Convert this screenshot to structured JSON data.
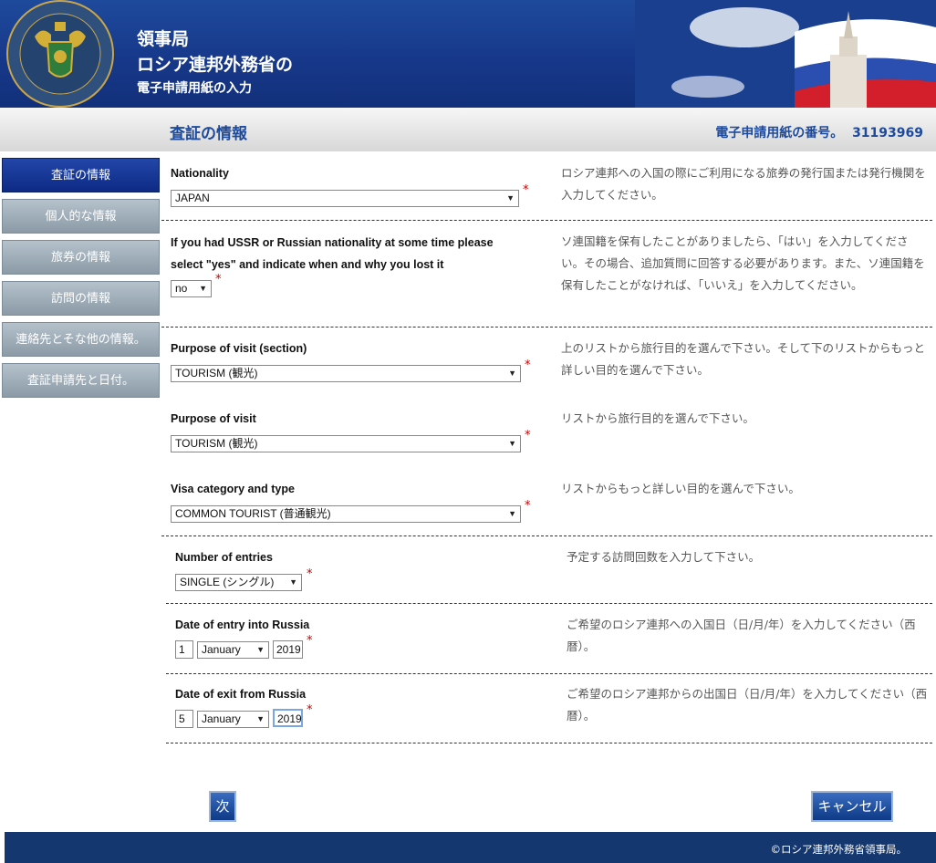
{
  "header": {
    "line1": "領事局",
    "line2": "ロシア連邦外務省の",
    "line3": "電子申請用紙の入力"
  },
  "titlebar": {
    "title": "査証の情報",
    "app_number_label": "電子申請用紙の番号。",
    "app_number": "31193969"
  },
  "sidebar": {
    "items": [
      {
        "label": "査証の情報"
      },
      {
        "label": "個人的な情報"
      },
      {
        "label": "旅券の情報"
      },
      {
        "label": "訪問の情報"
      },
      {
        "label": "連絡先とそな他の情報。"
      },
      {
        "label": "査証申請先と日付。"
      }
    ]
  },
  "form": {
    "nationality": {
      "label": "Nationality",
      "value": "JAPAN",
      "help": "ロシア連邦への入国の際にご利用になる旅券の発行国または発行機関を入力してください。"
    },
    "ussr": {
      "label": "If you had USSR or Russian nationality at some time please select \"yes\" and indicate when and why you lost it",
      "value": "no",
      "help": "ソ連国籍を保有したことがありましたら、「はい」を入力してください。その場合、追加質問に回答する必要があります。また、ソ連国籍を保有したことがなければ、「いいえ」を入力してください。"
    },
    "purpose_section": {
      "label": "Purpose of visit (section)",
      "value": "TOURISM (観光)",
      "help": "上のリストから旅行目的を選んで下さい。そして下のリストからもっと詳しい目的を選んで下さい。"
    },
    "purpose": {
      "label": "Purpose of visit",
      "value": "TOURISM (観光)",
      "help": "リストから旅行目的を選んで下さい。"
    },
    "visa_category": {
      "label": "Visa category and type",
      "value": "COMMON TOURIST (普通観光)",
      "help": "リストからもっと詳しい目的を選んで下さい。"
    },
    "entries": {
      "label": "Number of entries",
      "value": "SINGLE (シングル)",
      "help": "予定する訪問回数を入力して下さい。"
    },
    "entry_date": {
      "label": "Date of entry into Russia",
      "day": "1",
      "month": "January",
      "year": "2019",
      "help": "ご希望のロシア連邦への入国日（日/月/年）を入力してください（西暦）。"
    },
    "exit_date": {
      "label": "Date of exit from Russia",
      "day": "5",
      "month": "January",
      "year": "2019",
      "help": "ご希望のロシア連邦からの出国日（日/月/年）を入力してください（西暦）。"
    },
    "required_mark": "*"
  },
  "buttons": {
    "next": "次",
    "cancel": "キャンセル"
  },
  "footer": {
    "text": "©ロシア連邦外務省領事局。"
  },
  "colors": {
    "header_blue": "#1a3f94",
    "active_nav": "#0d2a85",
    "title_text": "#1e4a9c",
    "required": "#cc0000",
    "footer": "#13376e"
  }
}
